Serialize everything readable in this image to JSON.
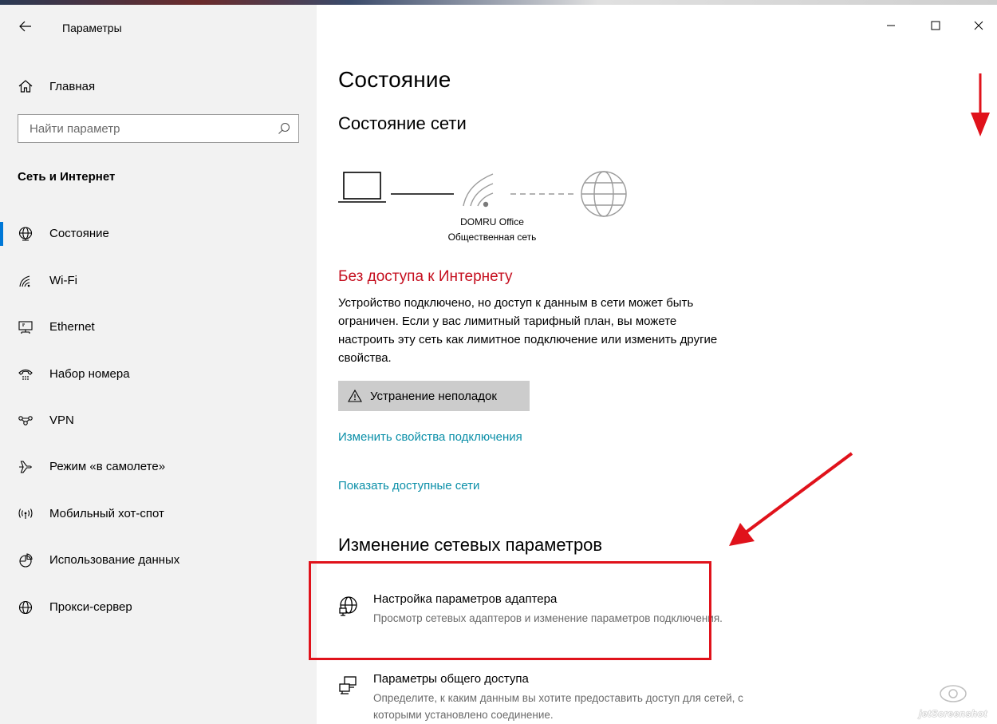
{
  "window": {
    "title": "Параметры",
    "controls": {
      "minimize": "minimize",
      "maximize": "maximize",
      "close": "close"
    }
  },
  "sidebar": {
    "home_label": "Главная",
    "search_placeholder": "Найти параметр",
    "section_title": "Сеть и Интернет",
    "items": [
      {
        "label": "Состояние",
        "icon": "status-globe-icon",
        "selected": true
      },
      {
        "label": "Wi-Fi",
        "icon": "wifi-icon",
        "selected": false
      },
      {
        "label": "Ethernet",
        "icon": "ethernet-icon",
        "selected": false
      },
      {
        "label": "Набор номера",
        "icon": "dialup-icon",
        "selected": false
      },
      {
        "label": "VPN",
        "icon": "vpn-icon",
        "selected": false
      },
      {
        "label": "Режим «в самолете»",
        "icon": "airplane-icon",
        "selected": false
      },
      {
        "label": "Мобильный хот-спот",
        "icon": "hotspot-icon",
        "selected": false
      },
      {
        "label": "Использование данных",
        "icon": "data-usage-icon",
        "selected": false
      },
      {
        "label": "Прокси-сервер",
        "icon": "proxy-globe-icon",
        "selected": false
      }
    ]
  },
  "content": {
    "title": "Состояние",
    "network_status_title": "Состояние сети",
    "network_name": "DOMRU Office",
    "network_type": "Общественная сеть",
    "status_heading": "Без доступа к Интернету",
    "status_description": "Устройство подключено, но доступ к данным в сети может быть ограничен. Если у вас лимитный тарифный план, вы можете настроить эту сеть как лимитное подключение или изменить другие свойства.",
    "troubleshoot_label": "Устранение неполадок",
    "link_change_properties": "Изменить свойства подключения",
    "link_show_networks": "Показать доступные сети",
    "change_settings_title": "Изменение сетевых параметров",
    "options": [
      {
        "title": "Настройка параметров адаптера",
        "description": "Просмотр сетевых адаптеров и изменение параметров подключения.",
        "icon": "adapter-icon"
      },
      {
        "title": "Параметры общего доступа",
        "description": "Определите, к каким данным вы хотите предоставить доступ для сетей, с которыми установлено соединение.",
        "icon": "sharing-icon"
      }
    ]
  },
  "colors": {
    "accent": "#0078d7",
    "error": "#c50f1f",
    "link": "#0a8fa8",
    "annotation": "#e0121b",
    "sidebar_bg": "#f2f2f2"
  },
  "watermark": "jetScreenshot"
}
